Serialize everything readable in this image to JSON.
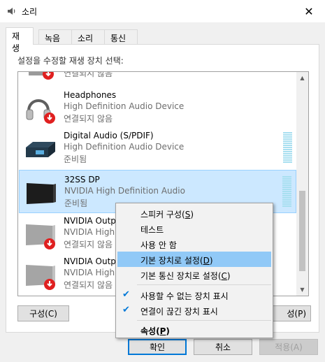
{
  "window": {
    "title": "소리",
    "close_glyph": "✕"
  },
  "tabs": [
    {
      "label": "재생",
      "active": true
    },
    {
      "label": "녹음",
      "active": false
    },
    {
      "label": "소리",
      "active": false
    },
    {
      "label": "통신",
      "active": false
    }
  ],
  "instruction": "설정을 수정할 재생 장치 선택:",
  "devices": [
    {
      "name": "",
      "desc": "",
      "status": "연결되지 않음",
      "icon": "speaker-disconnected-icon"
    },
    {
      "name": "Headphones",
      "desc": "High Definition Audio Device",
      "status": "연결되지 않음",
      "icon": "headphones-icon"
    },
    {
      "name": "Digital Audio (S/PDIF)",
      "desc": "High Definition Audio Device",
      "status": "준비됨",
      "icon": "digital-audio-icon"
    },
    {
      "name": "32SS DP",
      "desc": "NVIDIA High Definition Audio",
      "status": "준비됨",
      "icon": "monitor-icon"
    },
    {
      "name": "NVIDIA Outpu",
      "desc": "NVIDIA High",
      "status": "연결되지 않음",
      "icon": "monitor-disconnected-icon"
    },
    {
      "name": "NVIDIA Outpu",
      "desc": "NVIDIA High",
      "status": "연결되지 않음",
      "icon": "monitor-disconnected-icon"
    }
  ],
  "buttons": {
    "configure": "구성(C)",
    "properties": "성(P)",
    "ok": "확인",
    "cancel": "취소",
    "apply": "적용(A)"
  },
  "context_menu": {
    "configure_speakers": "스피커 구성",
    "configure_speakers_key": "S",
    "test": "테스트",
    "disable": "사용 안 함",
    "set_default": "기본 장치로 설정",
    "set_default_key": "D",
    "set_default_comm": "기본 통신 장치로 설정",
    "set_default_comm_key": "C",
    "show_disabled": "사용할 수 없는 장치 표시",
    "show_disconnected": "연결이 끊긴 장치 표시",
    "properties": "속성",
    "properties_key": "P"
  }
}
